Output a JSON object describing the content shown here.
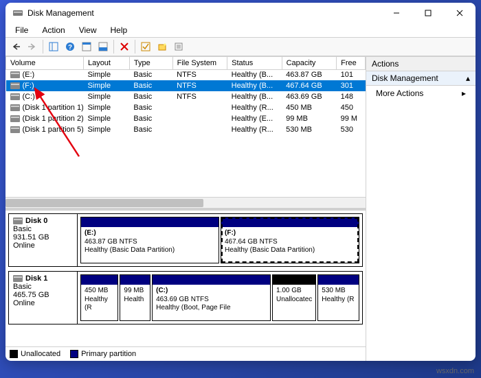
{
  "titlebar": {
    "title": "Disk Management"
  },
  "menubar": [
    "File",
    "Action",
    "View",
    "Help"
  ],
  "columns": [
    "Volume",
    "Layout",
    "Type",
    "File System",
    "Status",
    "Capacity",
    "Free"
  ],
  "rows": [
    {
      "vol": "(E:)",
      "layout": "Simple",
      "type": "Basic",
      "fs": "NTFS",
      "status": "Healthy (B...",
      "cap": "463.87 GB",
      "free": "101",
      "sel": false
    },
    {
      "vol": "(F:)",
      "layout": "Simple",
      "type": "Basic",
      "fs": "NTFS",
      "status": "Healthy (B...",
      "cap": "467.64 GB",
      "free": "301",
      "sel": true
    },
    {
      "vol": "(C:)",
      "layout": "Simple",
      "type": "Basic",
      "fs": "NTFS",
      "status": "Healthy (B...",
      "cap": "463.69 GB",
      "free": "148",
      "sel": false
    },
    {
      "vol": "(Disk 1 partition 1)",
      "layout": "Simple",
      "type": "Basic",
      "fs": "",
      "status": "Healthy (R...",
      "cap": "450 MB",
      "free": "450",
      "sel": false
    },
    {
      "vol": "(Disk 1 partition 2)",
      "layout": "Simple",
      "type": "Basic",
      "fs": "",
      "status": "Healthy (E...",
      "cap": "99 MB",
      "free": "99 M",
      "sel": false
    },
    {
      "vol": "(Disk 1 partition 5)",
      "layout": "Simple",
      "type": "Basic",
      "fs": "",
      "status": "Healthy (R...",
      "cap": "530 MB",
      "free": "530",
      "sel": false
    }
  ],
  "disks": [
    {
      "name": "Disk 0",
      "type": "Basic",
      "size": "931.51 GB",
      "status": "Online",
      "parts": [
        {
          "label": "(E:)",
          "line2": "463.87 GB NTFS",
          "line3": "Healthy (Basic Data Partition)",
          "flex": 1,
          "kind": "primary",
          "sel": false
        },
        {
          "label": "(F:)",
          "line2": "467.64 GB NTFS",
          "line3": "Healthy (Basic Data Partition)",
          "flex": 1,
          "kind": "primary",
          "sel": true
        }
      ]
    },
    {
      "name": "Disk 1",
      "type": "Basic",
      "size": "465.75 GB",
      "status": "Online",
      "parts": [
        {
          "label": "",
          "line2": "450 MB",
          "line3": "Healthy (R",
          "flex": 0.5,
          "kind": "primary",
          "sel": false
        },
        {
          "label": "",
          "line2": "99 MB",
          "line3": "Health",
          "flex": 0.4,
          "kind": "primary",
          "sel": false
        },
        {
          "label": "(C:)",
          "line2": "463.69 GB NTFS",
          "line3": "Healthy (Boot, Page File",
          "flex": 1.6,
          "kind": "primary",
          "sel": false
        },
        {
          "label": "",
          "line2": "1.00 GB",
          "line3": "Unallocatec",
          "flex": 0.55,
          "kind": "unalloc",
          "sel": false
        },
        {
          "label": "",
          "line2": "530 MB",
          "line3": "Healthy (R",
          "flex": 0.55,
          "kind": "primary",
          "sel": false
        }
      ]
    }
  ],
  "legend": {
    "unalloc": "Unallocated",
    "primary": "Primary partition"
  },
  "actions": {
    "header": "Actions",
    "section": "Disk Management",
    "more": "More Actions"
  },
  "watermark": "wsxdn.com"
}
